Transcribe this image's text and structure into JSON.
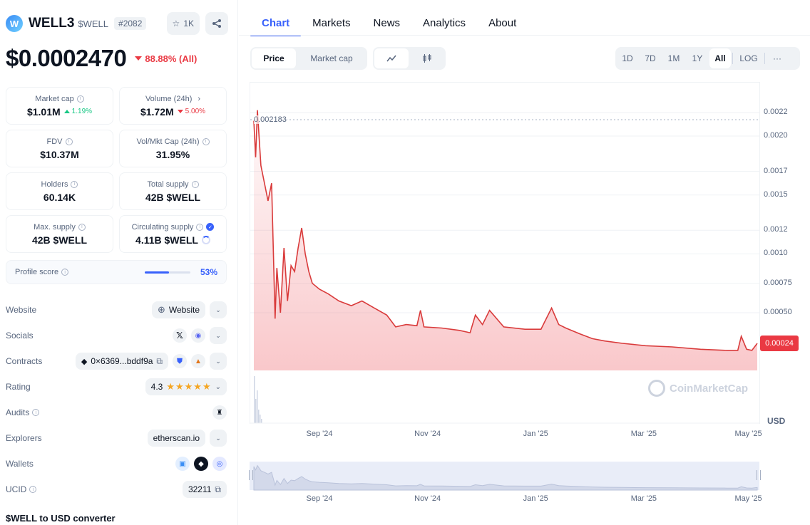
{
  "coin": {
    "logo_letter": "W",
    "name": "WELL3",
    "symbol": "$WELL",
    "rank": "#2082",
    "watchlist_count": "1K",
    "price": "$0.0002470",
    "change": "88.88% (All)"
  },
  "stats": [
    {
      "label": "Market cap",
      "value": "$1.01M",
      "sub": "1.19%",
      "sub_dir": "up",
      "info": true
    },
    {
      "label": "Volume (24h)",
      "value": "$1.72M",
      "sub": "5.00%",
      "sub_dir": "down",
      "chevron": true
    },
    {
      "label": "FDV",
      "value": "$10.37M",
      "info": true
    },
    {
      "label": "Vol/Mkt Cap (24h)",
      "value": "31.95%",
      "info": true
    },
    {
      "label": "Holders",
      "value": "60.14K",
      "info": true
    },
    {
      "label": "Total supply",
      "value": "42B $WELL",
      "info": true
    },
    {
      "label": "Max. supply",
      "value": "42B $WELL",
      "info": true
    },
    {
      "label": "Circulating supply",
      "value": "4.11B $WELL",
      "info": true,
      "verified": true
    }
  ],
  "profile": {
    "label": "Profile score",
    "value": "53%",
    "fraction": 0.53
  },
  "links": {
    "website_label": "Website",
    "website_value": "Website",
    "socials_label": "Socials",
    "contracts_label": "Contracts",
    "contract_value": "0×6369...bddf9a",
    "rating_label": "Rating",
    "rating_value": "4.3",
    "rating_stars": "★★★★★",
    "audits_label": "Audits",
    "explorers_label": "Explorers",
    "explorer_value": "etherscan.io",
    "wallets_label": "Wallets",
    "ucid_label": "UCID",
    "ucid_value": "32211"
  },
  "converter_title": "$WELL to USD converter",
  "tabs": [
    "Chart",
    "Markets",
    "News",
    "Analytics",
    "About"
  ],
  "chart_controls": {
    "mode": [
      "Price",
      "Market cap"
    ],
    "ranges": [
      "1D",
      "7D",
      "1M",
      "1Y",
      "All"
    ],
    "log": "LOG",
    "more": "···"
  },
  "colors": {
    "accent": "#3861fb",
    "down": "#ea3943",
    "up": "#16c784"
  },
  "chart_data": {
    "type": "area",
    "currency": "USD",
    "high_label": "0.002183",
    "current_label": "0.00024",
    "y_ticks": [
      "0.0022",
      "0.0020",
      "0.0017",
      "0.0015",
      "0.0012",
      "0.0010",
      "0.00075",
      "0.00050"
    ],
    "x_ticks": [
      "Sep '24",
      "Nov '24",
      "Jan '25",
      "Mar '25",
      "May '25"
    ],
    "watermark": "CoinMarketCap",
    "series": [
      {
        "x": [
          "2024-08-01",
          "2024-08-02",
          "2024-08-03",
          "2024-08-05",
          "2024-08-07",
          "2024-08-09",
          "2024-08-11",
          "2024-08-13",
          "2024-08-14",
          "2024-08-16",
          "2024-08-18",
          "2024-08-20",
          "2024-08-22",
          "2024-08-24",
          "2024-08-26",
          "2024-08-28",
          "2024-08-30",
          "2024-09-01",
          "2024-09-03",
          "2024-09-07",
          "2024-09-12",
          "2024-09-18",
          "2024-09-25",
          "2024-10-01",
          "2024-10-08",
          "2024-10-15",
          "2024-10-20",
          "2024-10-26",
          "2024-11-01",
          "2024-11-03",
          "2024-11-05",
          "2024-11-15",
          "2024-11-25",
          "2024-12-01",
          "2024-12-04",
          "2024-12-08",
          "2024-12-12",
          "2024-12-20",
          "2025-01-01",
          "2025-01-10",
          "2025-01-16",
          "2025-01-20",
          "2025-01-24",
          "2025-02-01",
          "2025-02-08",
          "2025-02-15",
          "2025-02-25",
          "2025-03-10",
          "2025-03-25",
          "2025-04-10",
          "2025-04-25",
          "2025-05-01",
          "2025-05-03",
          "2025-05-06",
          "2025-05-09",
          "2025-05-12"
        ],
        "y": [
          0.00213,
          0.00182,
          0.00222,
          0.00175,
          0.0016,
          0.00145,
          0.0016,
          0.00045,
          0.00088,
          0.0005,
          0.00105,
          0.0006,
          0.0009,
          0.00085,
          0.00105,
          0.00122,
          0.001,
          0.00085,
          0.00075,
          0.0007,
          0.00066,
          0.0006,
          0.00056,
          0.0006,
          0.00054,
          0.00048,
          0.00038,
          0.0004,
          0.00039,
          0.00052,
          0.00038,
          0.00037,
          0.00035,
          0.00033,
          0.00048,
          0.0004,
          0.00052,
          0.00038,
          0.00036,
          0.00036,
          0.00054,
          0.0004,
          0.00037,
          0.00032,
          0.00028,
          0.00026,
          0.00024,
          0.00022,
          0.00021,
          0.00019,
          0.00018,
          0.00018,
          0.0003,
          0.00019,
          0.00018,
          0.00024
        ]
      }
    ]
  }
}
